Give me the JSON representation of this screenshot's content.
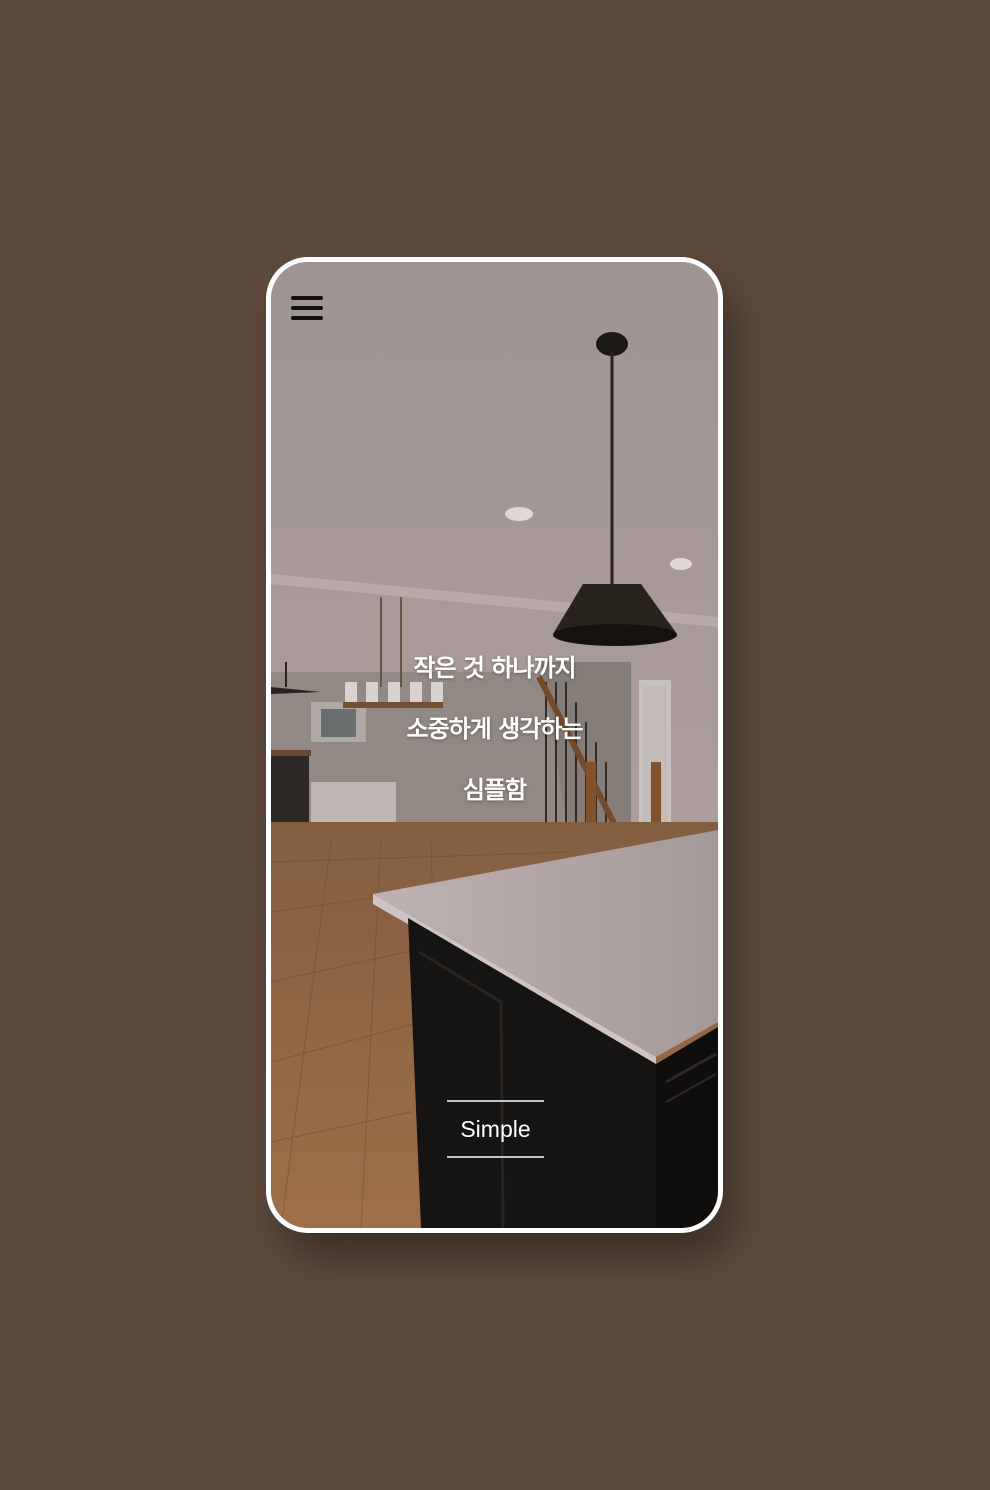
{
  "headline": {
    "line1": "작은 것 하나까지",
    "line2": "소중하게 생각하는",
    "line3": "심플함"
  },
  "brand_button": {
    "label": "Simple"
  },
  "icons": {
    "menu": "hamburger-menu-icon"
  },
  "colors": {
    "background": "#5d4a3c",
    "frame": "#ffffff",
    "text": "#ffffff"
  }
}
